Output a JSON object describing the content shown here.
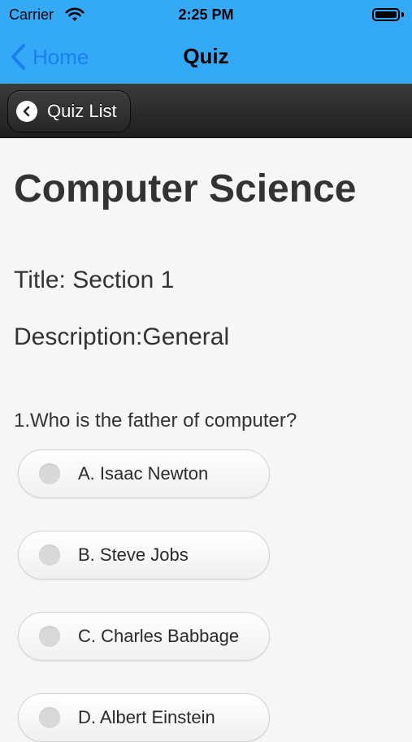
{
  "status_bar": {
    "carrier": "Carrier",
    "time": "2:25 PM"
  },
  "nav": {
    "back_label": "Home",
    "title": "Quiz"
  },
  "toolbar": {
    "quiz_list_label": "Quiz List"
  },
  "quiz": {
    "subject": "Computer Science",
    "title_line": "Title: Section 1",
    "description_line": "Description:General",
    "question": "1.Who is the father of computer?",
    "options": [
      {
        "label": "A. Isaac Newton"
      },
      {
        "label": "B. Steve Jobs"
      },
      {
        "label": "C. Charles Babbage"
      },
      {
        "label": "D. Albert Einstein"
      }
    ]
  },
  "colors": {
    "nav_blue": "#34aaf6",
    "link_blue": "#1c7ff0",
    "toolbar_dark": "#2a2a2a"
  }
}
